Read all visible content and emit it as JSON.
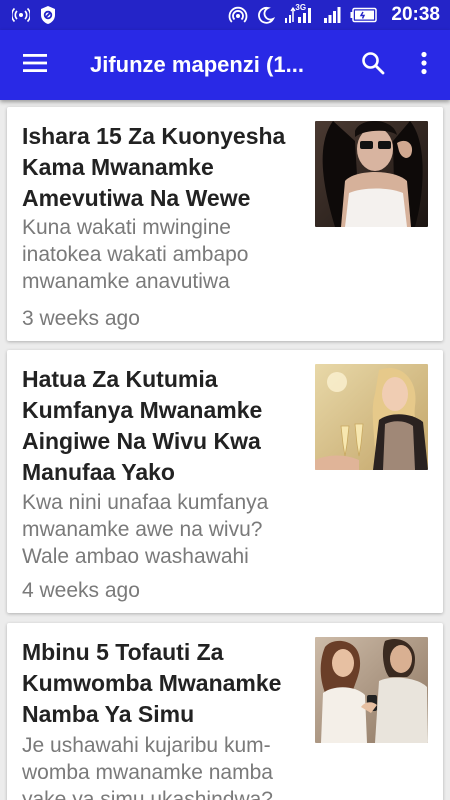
{
  "status_bar": {
    "time": "20:38",
    "network_badge": "3G",
    "left_icons": [
      "hotspot-icon",
      "shield-app-icon"
    ],
    "right_icons": [
      "hotspot-icon",
      "moon-icon",
      "signal-icon",
      "signal-icon",
      "battery-icon"
    ]
  },
  "app_bar": {
    "title": "Jifunze mapenzi (1...",
    "icons": [
      "menu-icon",
      "search-icon",
      "more-vert-icon"
    ],
    "color": "#2929e6"
  },
  "articles": [
    {
      "title": "Ishara 15 Za Kuonyesha Kama Mwanamke Amevutiwa Na Wewe",
      "excerpt": "Kuna wakati mwingine inatokea wakati ambapo mwanamke anavutiwa",
      "time": "3 weeks ago"
    },
    {
      "title": "Hatua Za Kutumia Kumfanya Mwanamke Aingiwe Na Wivu Kwa Manufaa Yako",
      "excerpt": "Kwa nini unafaa kumfanya mwanamke awe na wivu? Wale ambao washawahi",
      "time": "4 weeks ago"
    },
    {
      "title": "Mbinu 5 Tofauti Za Kumwomba Mwanamke Namba Ya Simu",
      "excerpt": "Je ushawahi kujaribu kum-womba mwanamke namba yake ya simu ukashindwa?",
      "time": ""
    }
  ]
}
